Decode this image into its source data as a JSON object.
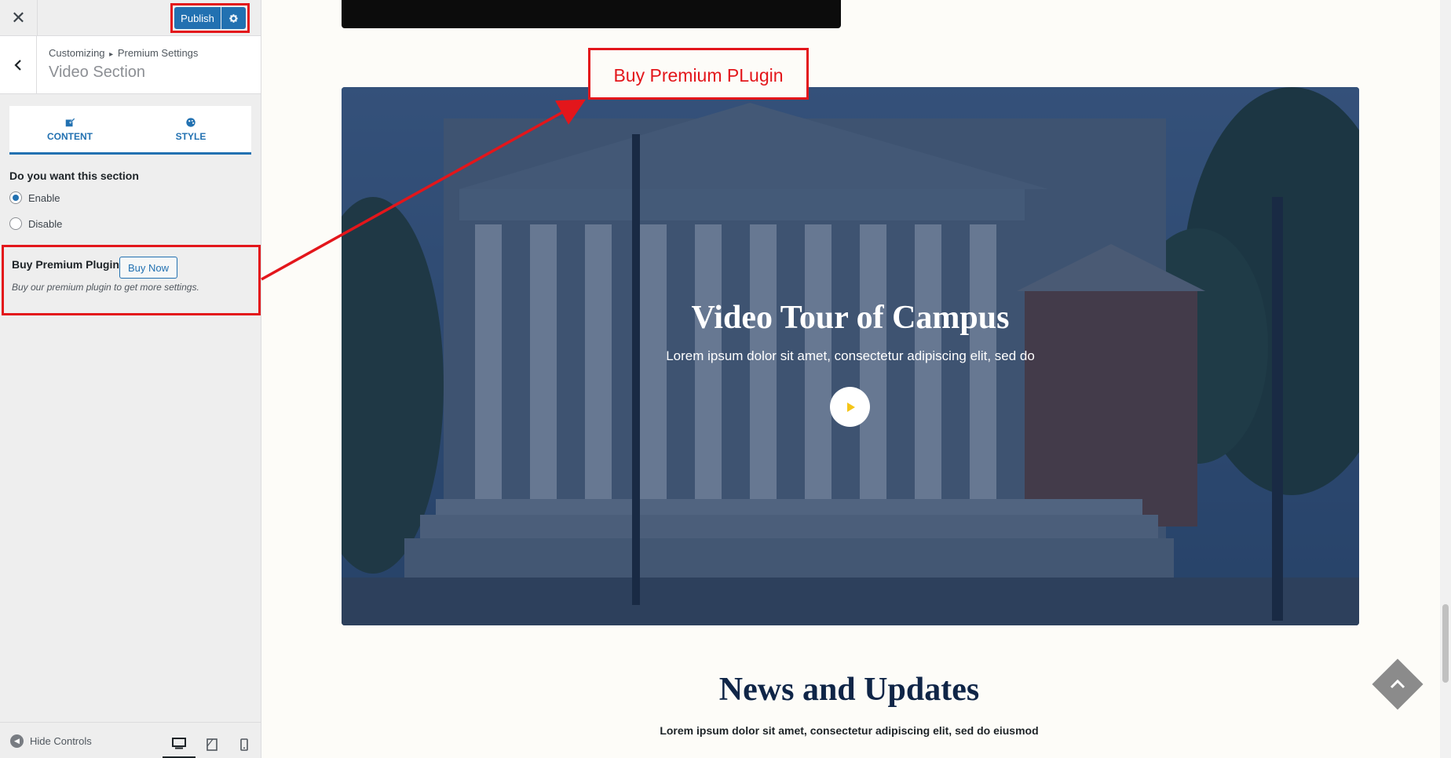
{
  "topbar": {
    "close_symbol": "✕",
    "publish_label": "Publish"
  },
  "section": {
    "breadcrumb_root": "Customizing",
    "breadcrumb_sep": "▸",
    "breadcrumb_parent": "Premium Settings",
    "title": "Video Section"
  },
  "tabs": [
    {
      "label": "CONTENT",
      "icon": "edit-icon"
    },
    {
      "label": "STYLE",
      "icon": "palette-icon"
    }
  ],
  "enable_question": "Do you want this section",
  "radio_options": [
    {
      "label": "Enable",
      "checked": true
    },
    {
      "label": "Disable",
      "checked": false
    }
  ],
  "premium": {
    "title": "Buy Premium Plugin",
    "button": "Buy Now",
    "description": "Buy our premium plugin to get more settings."
  },
  "footer": {
    "hide_controls": "Hide Controls"
  },
  "preview": {
    "buy_label": "Buy Premium PLugin",
    "hero_title": "Video Tour of Campus",
    "hero_subtitle": "Lorem ipsum dolor sit amet, consectetur adipiscing elit, sed do",
    "news_title": "News and Updates",
    "news_subtitle": "Lorem ipsum dolor sit amet, consectetur adipiscing elit, sed do eiusmod"
  },
  "colors": {
    "accent": "#2271b1",
    "annotation": "#e3161b",
    "heading": "#0f2547",
    "play": "#f5c518"
  }
}
